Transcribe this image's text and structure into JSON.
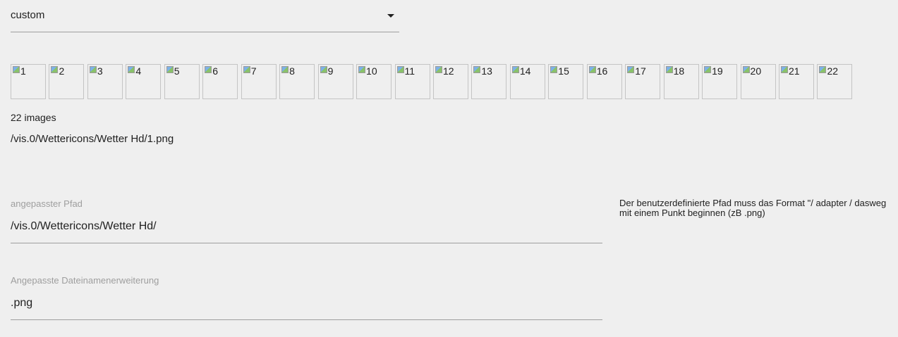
{
  "select": {
    "value": "custom"
  },
  "images": [
    "1",
    "2",
    "3",
    "4",
    "5",
    "6",
    "7",
    "8",
    "9",
    "10",
    "11",
    "12",
    "13",
    "14",
    "15",
    "16",
    "17",
    "18",
    "19",
    "20",
    "21",
    "22"
  ],
  "image_count_text": "22 images",
  "current_path": "/vis.0/Wettericons/Wetter Hd/1.png",
  "path_field": {
    "label": "angepasster Pfad",
    "value": "/vis.0/Wettericons/Wetter Hd/"
  },
  "hint": {
    "line1": "Der benutzerdefinierte Pfad muss das Format \"/ adapter / dasweg",
    "line2": "mit einem Punkt beginnen (zB .png)"
  },
  "ext_field": {
    "label": "Angepasste Dateinamenerweiterung",
    "value": ".png"
  }
}
